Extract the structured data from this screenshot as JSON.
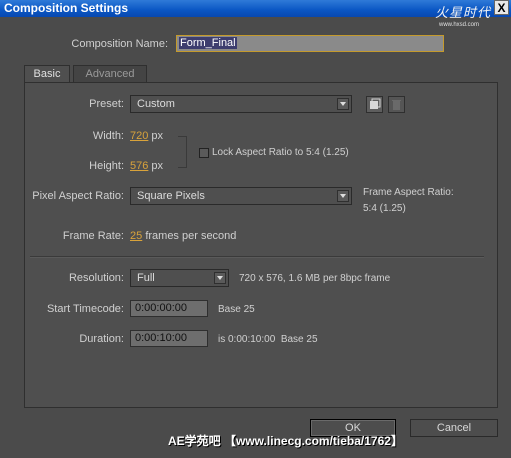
{
  "window": {
    "title": "Composition Settings",
    "close_label": "X",
    "logo_text": "火星时代",
    "logo_url": "www.hxsd.com"
  },
  "comp_name": {
    "label": "Composition Name:",
    "value": "Form_Final"
  },
  "tabs": [
    {
      "label": "Basic",
      "active": true
    },
    {
      "label": "Advanced",
      "active": false
    }
  ],
  "preset": {
    "label": "Preset:",
    "value": "Custom"
  },
  "width": {
    "label": "Width:",
    "value": "720",
    "unit": "px"
  },
  "height": {
    "label": "Height:",
    "value": "576",
    "unit": "px"
  },
  "lock_aspect": {
    "label": "Lock Aspect Ratio to 5:4 (1.25)",
    "checked": false
  },
  "pixel_aspect": {
    "label": "Pixel Aspect Ratio:",
    "value": "Square Pixels",
    "frame_aspect_label": "Frame Aspect Ratio:",
    "frame_aspect_value": "5:4 (1.25)"
  },
  "frame_rate": {
    "label": "Frame Rate:",
    "value": "25",
    "unit": "frames per second"
  },
  "resolution": {
    "label": "Resolution:",
    "value": "Full",
    "info": "720 x 576, 1.6 MB per 8bpc frame"
  },
  "start_timecode": {
    "label": "Start Timecode:",
    "value": "0:00:00:00",
    "base": "Base 25"
  },
  "duration": {
    "label": "Duration:",
    "value": "0:00:10:00",
    "info": "is 0:00:10:00  Base 25"
  },
  "buttons": {
    "ok": "OK",
    "cancel": "Cancel"
  },
  "watermark": "AE学苑吧 【www.linecg.com/tieba/1762】"
}
